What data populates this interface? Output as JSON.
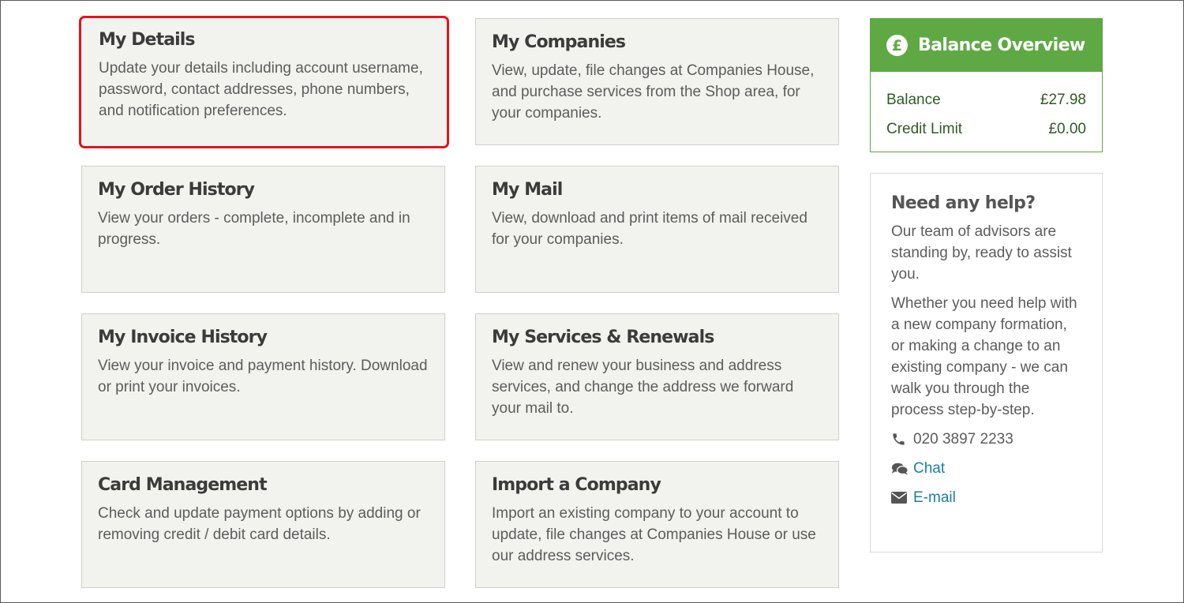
{
  "cards": [
    {
      "title": "My Details",
      "desc": "Update your details including account username, password, contact addresses, phone numbers, and notification preferences."
    },
    {
      "title": "My Companies",
      "desc": "View, update, file changes at Companies House, and purchase services from the Shop area, for your companies."
    },
    {
      "title": "My Order History",
      "desc": "View your orders - complete, incomplete and in progress."
    },
    {
      "title": "My Mail",
      "desc": "View, download and print items of mail received for your companies."
    },
    {
      "title": "My Invoice History",
      "desc": "View your invoice and payment history. Download or print your invoices."
    },
    {
      "title": "My Services & Renewals",
      "desc": "View and renew your business and address services, and change the address we forward your mail to."
    },
    {
      "title": "Card Management",
      "desc": "Check and update payment options by adding or removing credit / debit card details."
    },
    {
      "title": "Import a Company",
      "desc": "Import an existing company to your account to update, file changes at Companies House or use our address services."
    }
  ],
  "balance": {
    "icon": "pound-circle-icon",
    "title": "Balance Overview",
    "rows": [
      {
        "label": "Balance",
        "value": "£27.98"
      },
      {
        "label": "Credit Limit",
        "value": "£0.00"
      }
    ]
  },
  "help": {
    "title": "Need any help?",
    "p1": "Our team of advisors are standing by, ready to assist you.",
    "p2": "Whether you need help with a new company formation, or making a change to an existing company - we can walk you through the process step-by-step.",
    "phone": "020 3897 2233",
    "chat": "Chat",
    "email": "E-mail"
  },
  "colors": {
    "accent_green": "#5ea944",
    "highlight_red": "#e0151e",
    "link_blue": "#1a7fa5",
    "card_bg": "#f2f2ef"
  }
}
